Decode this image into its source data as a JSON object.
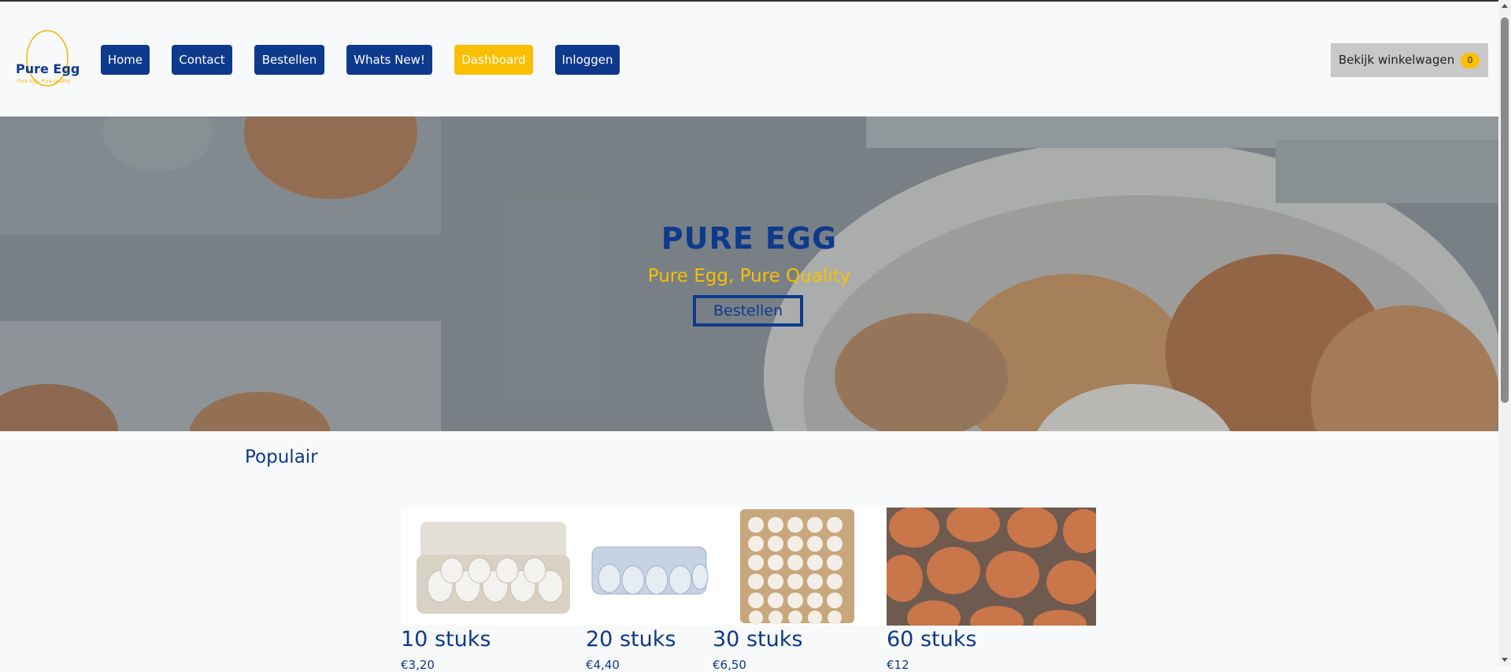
{
  "logo": {
    "name": "Pure Egg",
    "tagline": "Pure Egg, Pure Quality"
  },
  "nav": [
    "Home",
    "Contact",
    "Bestellen",
    "Whats New!",
    "Dashboard",
    "Inloggen"
  ],
  "cart": {
    "label": "Bekijk winkelwagen",
    "count": "0"
  },
  "hero": {
    "title": "PURE EGG",
    "subtitle": "Pure Egg, Pure Quality",
    "button": "Bestellen"
  },
  "popular": {
    "title": "Populair",
    "products": [
      {
        "name": "10 stuks",
        "price": "€3,20"
      },
      {
        "name": "20 stuks",
        "price": "€4,40"
      },
      {
        "name": "30 stuks",
        "price": "€6,50"
      },
      {
        "name": "60 stuks",
        "price": "€12"
      }
    ]
  },
  "colors": {
    "brand": "#0d3a8c",
    "accent": "#f9bf00"
  }
}
